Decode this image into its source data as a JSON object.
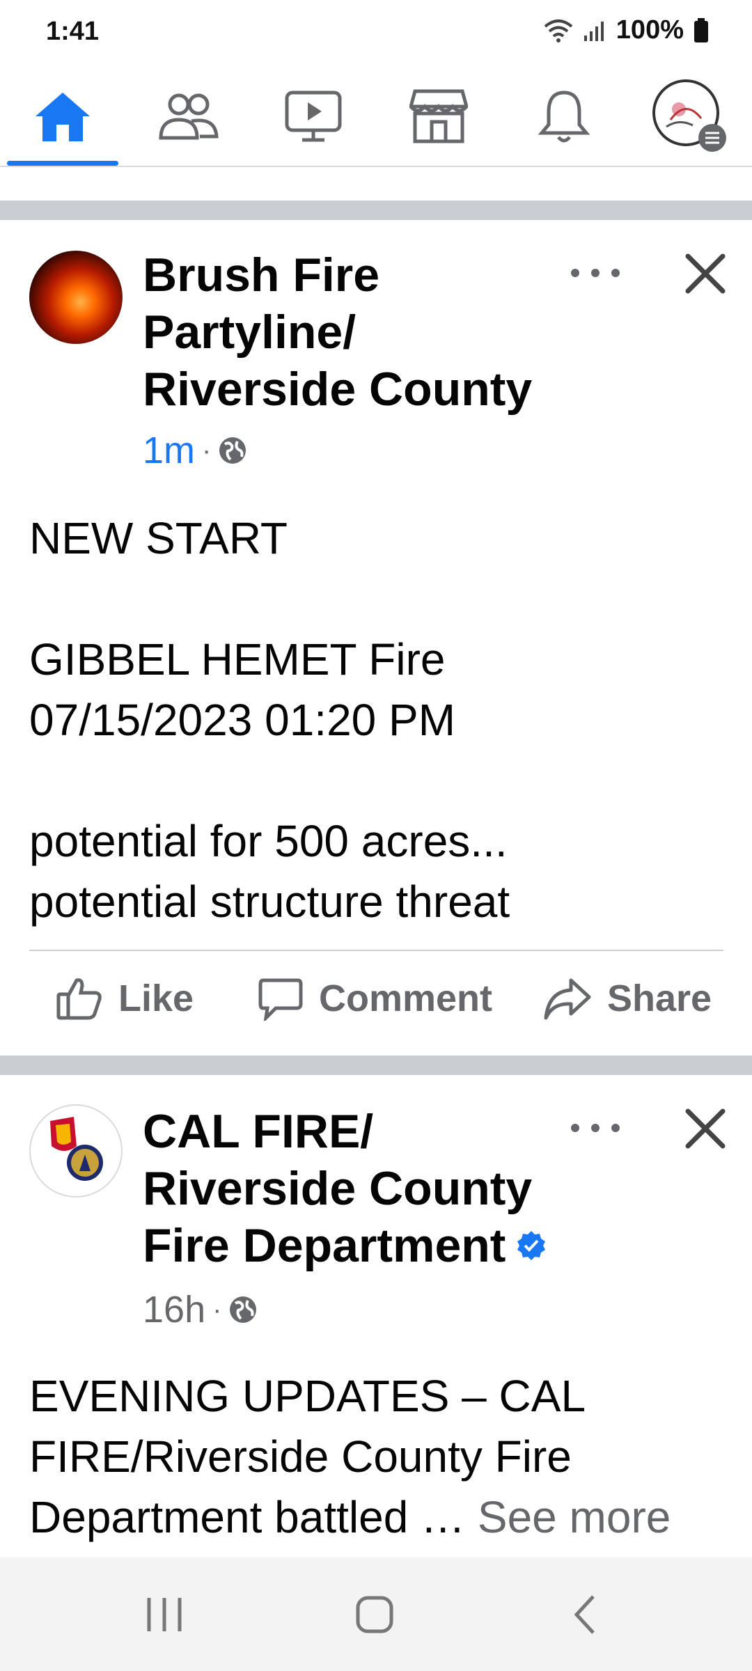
{
  "status_bar": {
    "time": "1:41",
    "battery": "100%"
  },
  "nav": {
    "tabs": [
      {
        "name": "home",
        "icon": "home-icon",
        "active": true
      },
      {
        "name": "friends",
        "icon": "friends-icon",
        "active": false
      },
      {
        "name": "watch",
        "icon": "video-icon",
        "active": false
      },
      {
        "name": "marketplace",
        "icon": "store-icon",
        "active": false
      },
      {
        "name": "notifications",
        "icon": "bell-icon",
        "active": false
      },
      {
        "name": "menu",
        "icon": "profile-menu-icon",
        "active": false
      }
    ],
    "accent": "#1877f2"
  },
  "posts": [
    {
      "author": "Brush Fire Partyline/ Riverside County",
      "author_lines": [
        "Brush Fire",
        "Partyline/",
        "Riverside County"
      ],
      "time": "1m",
      "time_color": "#1877f2",
      "audience_icon": "globe-icon",
      "body_lines": [
        "NEW START",
        "",
        "GIBBEL HEMET Fire",
        "07/15/2023 01:20 PM",
        "",
        "potential for 500 acres...",
        "potential structure threat"
      ],
      "actions": {
        "like": "Like",
        "comment": "Comment",
        "share": "Share"
      }
    },
    {
      "author_lines": [
        "CAL FIRE/",
        "Riverside County",
        "Fire Department"
      ],
      "verified": true,
      "time": "16h",
      "audience_icon": "globe-icon",
      "body_lines": [
        "EVENING UPDATES – CAL",
        "FIRE/Riverside County Fire",
        "Department battled …"
      ],
      "see_more": "See more"
    }
  ]
}
